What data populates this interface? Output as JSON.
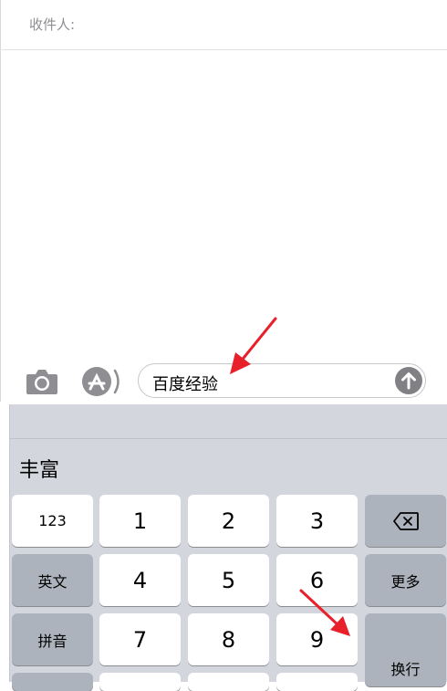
{
  "recipient": {
    "label": "收件人:"
  },
  "input_bar": {
    "camera_icon": "camera-icon",
    "apps_icon": "app-store-icon",
    "message_text": "百度经验",
    "send_icon": "arrow-up-icon"
  },
  "keyboard": {
    "candidate": "丰富",
    "left_column": [
      "123",
      "英文",
      "拼音"
    ],
    "digits_row1": [
      "1",
      "2",
      "3"
    ],
    "digits_row2": [
      "4",
      "5",
      "6"
    ],
    "digits_row3": [
      "7",
      "8",
      "9"
    ],
    "more_label": "更多",
    "return_label": "换行",
    "delete_icon": "backspace-icon"
  },
  "colors": {
    "keyboard_bg": "#d3d6dc",
    "dark_key": "#adb3bc",
    "annotation_arrow": "#e8202a",
    "send_button": "#808085"
  }
}
